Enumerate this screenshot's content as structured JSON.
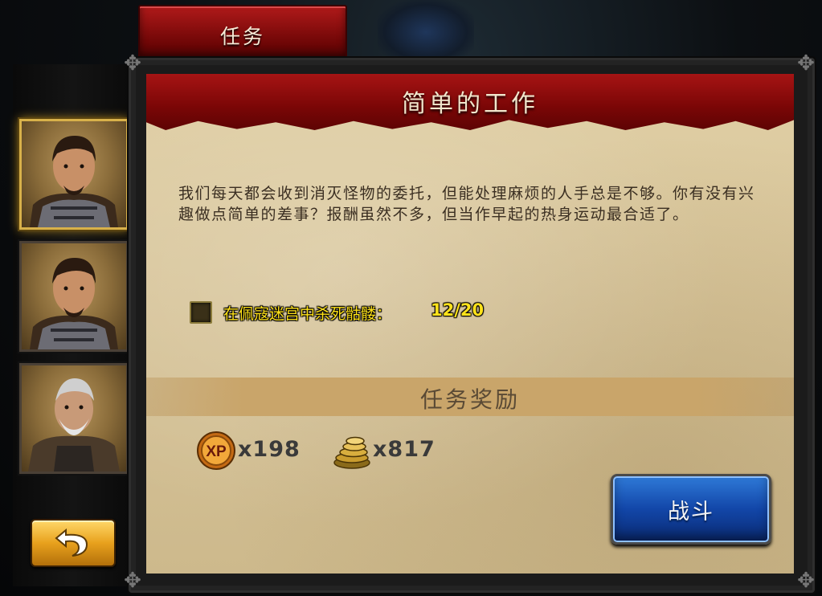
{
  "tab": {
    "label": "任务"
  },
  "quest": {
    "title": "简单的工作",
    "description": "我们每天都会收到消灭怪物的委托，但能处理麻烦的人手总是不够。你有没有兴趣做点简单的差事？报酬虽然不多，但当作早起的热身运动最合适了。",
    "objective": {
      "text": "在佩寇迷宫中杀死骷髅：",
      "progress": "12/20"
    }
  },
  "rewards": {
    "title": "任务奖励",
    "xp": {
      "icon": "xp-icon",
      "value": "x198"
    },
    "gold": {
      "icon": "gold-coins-icon",
      "value": "x817"
    }
  },
  "buttons": {
    "fight": "战斗",
    "back_icon": "return-arrow-icon"
  },
  "portraits": [
    {
      "icon": "warrior-portrait",
      "selected": true
    },
    {
      "icon": "warrior-portrait",
      "selected": false
    },
    {
      "icon": "old-blacksmith-portrait",
      "selected": false
    }
  ],
  "colors": {
    "accent_red": "#8a0a0a",
    "parchment": "#d6c398",
    "objective_yellow": "#ffe21a",
    "button_blue": "#1246a8"
  }
}
